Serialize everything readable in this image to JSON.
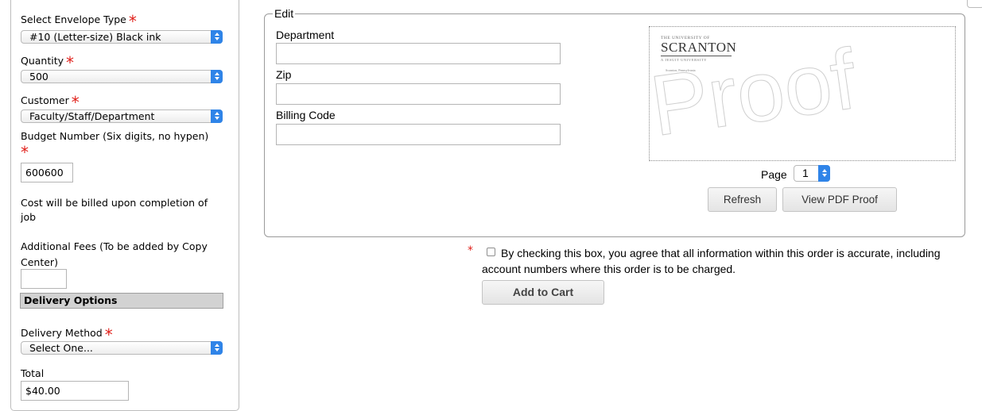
{
  "order_form": {
    "envelope_type": {
      "label": "Select Envelope Type",
      "value": "#10 (Letter-size) Black ink"
    },
    "quantity": {
      "label": "Quantity",
      "value": "500"
    },
    "customer": {
      "label": "Customer",
      "value": "Faculty/Staff/Department"
    },
    "budget_number": {
      "label": "Budget Number (Six digits, no hypen)",
      "value": "600600"
    },
    "billing_note": "Cost will be billed upon completion of job",
    "additional_fees": {
      "label": "Additional Fees (To be added by Copy Center)",
      "value": ""
    },
    "delivery_options_heading": "Delivery Options",
    "delivery_method": {
      "label": "Delivery Method",
      "value": "Select One..."
    },
    "total": {
      "label": "Total",
      "value": "$40.00"
    },
    "required_marker": "*"
  },
  "edit": {
    "legend": "Edit",
    "fields": [
      {
        "label": "Department",
        "value": ""
      },
      {
        "label": "Zip",
        "value": ""
      },
      {
        "label": "Billing Code",
        "value": ""
      }
    ]
  },
  "proof": {
    "logo_line1": "THE UNIVERSITY OF",
    "logo_line2": "SCRANTON",
    "logo_line3": "A JESUIT UNIVERSITY",
    "logo_address": "Scranton, Pennsylvania",
    "watermark": "Proof",
    "page_label": "Page",
    "page_value": "1",
    "refresh_label": "Refresh",
    "view_pdf_label": "View PDF Proof"
  },
  "agreement": {
    "required_marker": "*",
    "text": "By checking this box, you agree that all information within this order is accurate, including account numbers where this order is to be charged.",
    "checked": false
  },
  "cart": {
    "add_label": "Add to Cart"
  },
  "colors": {
    "required": "#e0201a",
    "select_accent": "#2f84e8",
    "section_bar": "#d2d2d2"
  }
}
